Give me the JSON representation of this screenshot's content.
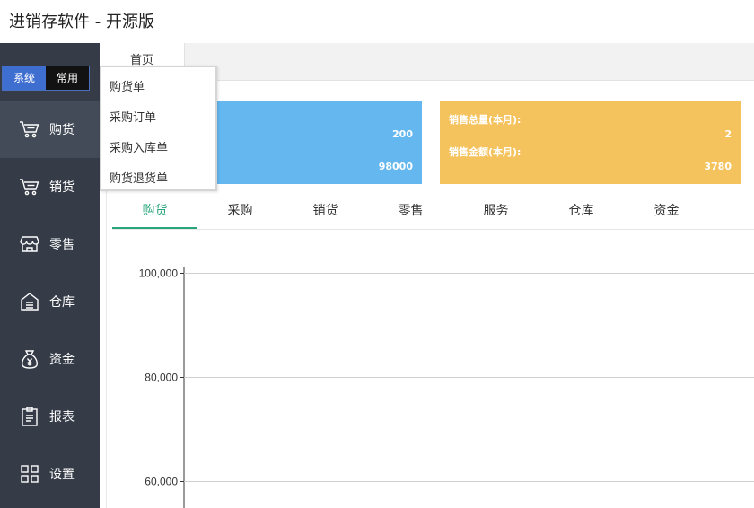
{
  "app": {
    "title": "进销存软件 - 开源版"
  },
  "sidebar": {
    "segments": {
      "system": "系统",
      "common": "常用"
    },
    "items": [
      {
        "label": "购货",
        "icon": "cart-icon",
        "active": true
      },
      {
        "label": "销货",
        "icon": "cart-icon",
        "active": false
      },
      {
        "label": "零售",
        "icon": "store-icon",
        "active": false
      },
      {
        "label": "仓库",
        "icon": "warehouse-icon",
        "active": false
      },
      {
        "label": "资金",
        "icon": "money-bag-icon",
        "active": false
      },
      {
        "label": "报表",
        "icon": "clipboard-icon",
        "active": false
      },
      {
        "label": "设置",
        "icon": "grid-icon",
        "active": false
      }
    ]
  },
  "tabs": {
    "home": "首页"
  },
  "cards": {
    "purchase": {
      "qty": "200",
      "amount": "98000"
    },
    "sales": {
      "qty_label": "销售总量(本月):",
      "qty": "2",
      "amount_label": "销售金额(本月):",
      "amount": "3780"
    }
  },
  "dropdown": {
    "items": [
      "购货单",
      "采购订单",
      "采购入库单",
      "购货退货单"
    ]
  },
  "subtabs": {
    "items": [
      "购货",
      "采购",
      "销货",
      "零售",
      "服务",
      "仓库",
      "资金"
    ],
    "active": 0
  },
  "chart_data": {
    "type": "line",
    "y_ticks": [
      "100,000",
      "80,000",
      "60,000"
    ],
    "y_tick_values": [
      100000,
      80000,
      60000
    ],
    "ylim": [
      60000,
      100000
    ],
    "grid": true,
    "series": []
  },
  "colors": {
    "sidebar_bg": "#353c48",
    "accent_green": "#2aa57d",
    "card_blue": "#64b7ef",
    "card_orange": "#f5c35d",
    "segment_blue": "#3f6ed1"
  }
}
